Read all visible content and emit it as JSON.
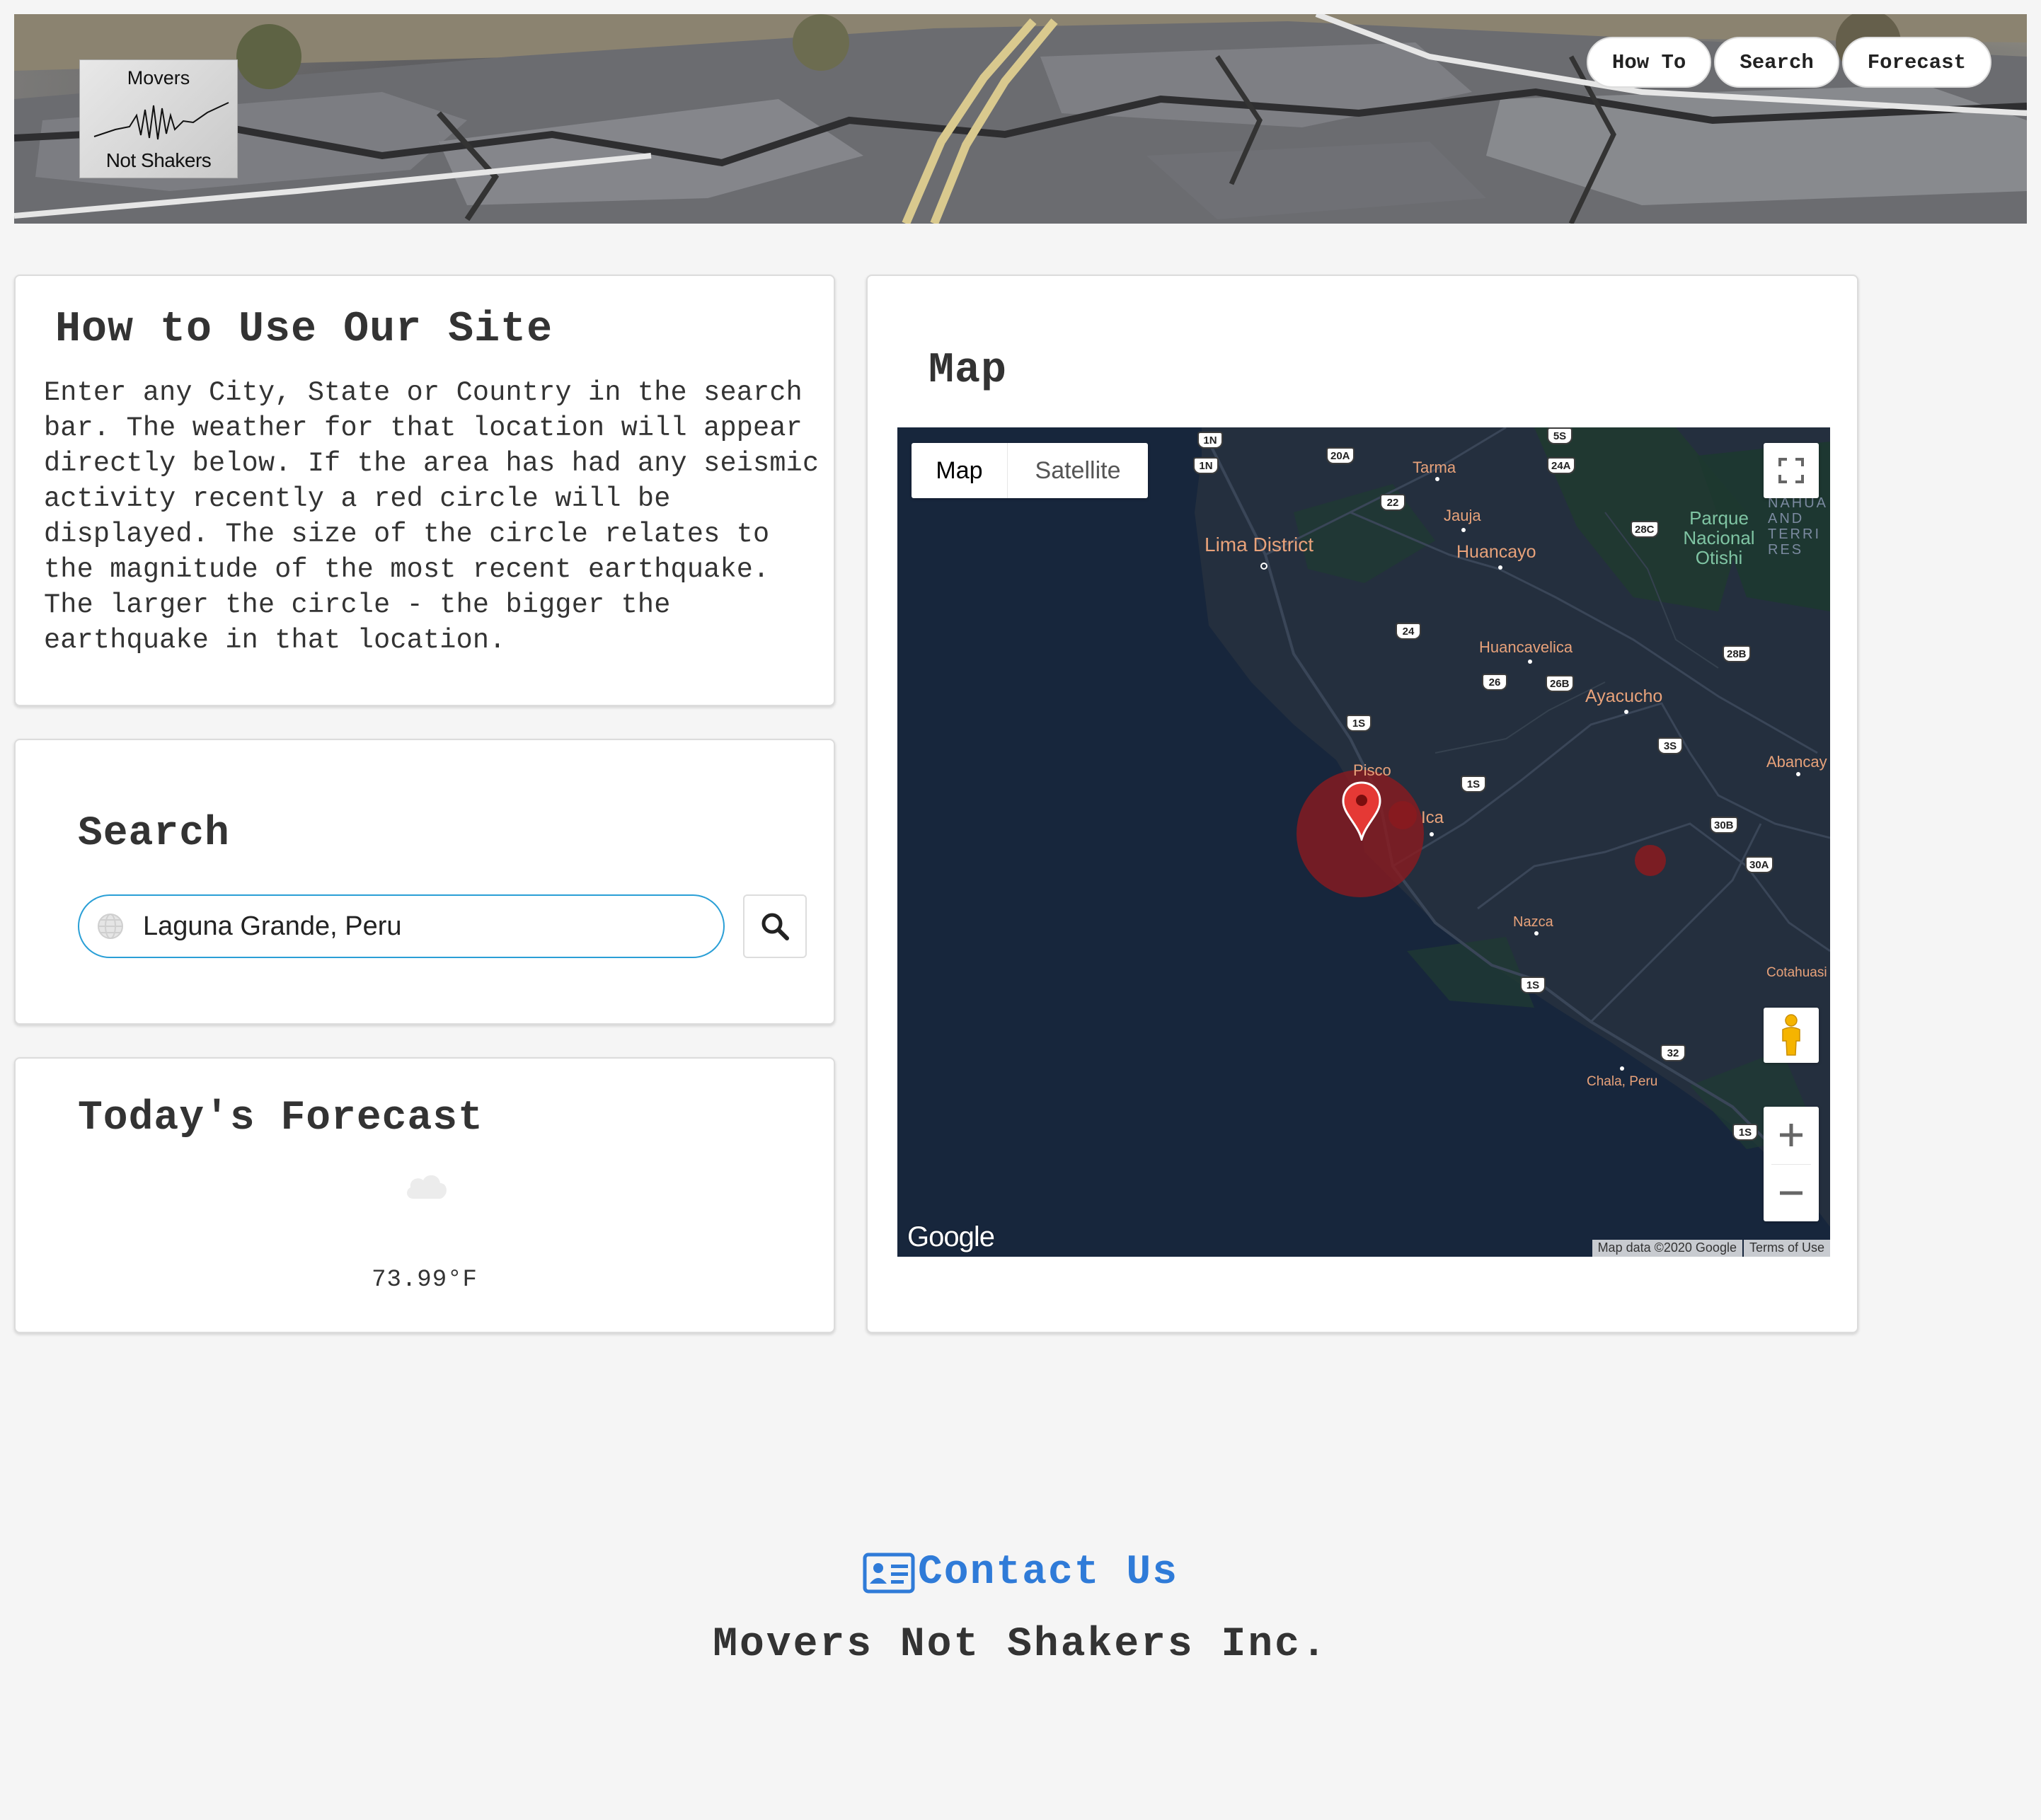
{
  "header": {
    "logo": {
      "line1": "Movers",
      "line2": "Not Shakers"
    },
    "nav": [
      {
        "label": "How To"
      },
      {
        "label": "Search"
      },
      {
        "label": "Forecast"
      }
    ]
  },
  "howto": {
    "title": "How to Use Our Site",
    "body": "Enter any City, State or Country in the search bar. The weather for that location will appear directly below. If the area has had any seismic activity recently a red circle will be displayed. The size of the circle relates to the magnitude of the most recent earthquake. The larger the circle - the bigger the earthquake in that location."
  },
  "search": {
    "title": "Search",
    "value": "Laguna Grande, Peru"
  },
  "forecast": {
    "title": "Today's Forecast",
    "icon": "cloud-icon",
    "temperature": "73.99°F"
  },
  "map": {
    "title": "Map",
    "type_map": "Map",
    "type_satellite": "Satellite",
    "google_logo": "Google",
    "attribution": "Map data ©2020 Google",
    "terms": "Terms of Use",
    "places": {
      "lima": "Lima District",
      "tarma": "Tarma",
      "jauja": "Jauja",
      "huancayo": "Huancayo",
      "huancavelica": "Huancavelica",
      "ayacucho": "Ayacucho",
      "pisco": "Pisco",
      "ica": "Ica",
      "nazca": "Nazca",
      "abancay": "Abancay",
      "cotahuasi": "Cotahuasi",
      "chala": "Chala, Peru",
      "parque": "Parque Nacional Otishi",
      "reserve": "NAHUA AND TERRI RES"
    },
    "shields": [
      "1N",
      "1N",
      "20A",
      "5S",
      "24A",
      "22",
      "28C",
      "24",
      "26",
      "26B",
      "28B",
      "1S",
      "3S",
      "1S",
      "30B",
      "30A",
      "1S",
      "32",
      "1S"
    ]
  },
  "footer": {
    "contact": "Contact Us",
    "company": "Movers Not Shakers Inc."
  },
  "colors": {
    "accent": "#2a9fd6",
    "link": "#2f7bd8",
    "quake_circle": "#8b1a1f",
    "map_water": "#17263c",
    "map_land": "#242f3e",
    "marker": "#e53935"
  }
}
